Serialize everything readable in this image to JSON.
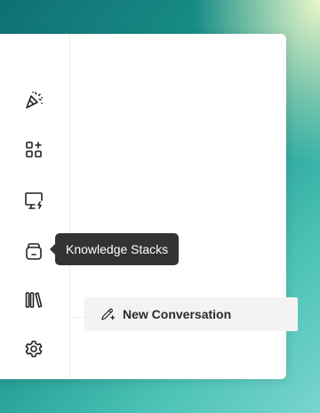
{
  "sidebar": {
    "items": [
      {
        "icon": "party-popper-icon"
      },
      {
        "icon": "grid-plus-icon"
      },
      {
        "icon": "monitor-bolt-icon"
      },
      {
        "icon": "knowledge-stack-icon"
      },
      {
        "icon": "library-books-icon"
      },
      {
        "icon": "gear-icon"
      }
    ]
  },
  "tooltip": {
    "text": "Knowledge Stacks"
  },
  "new_conversation": {
    "label": "New Conversation",
    "icon": "pen-plus-icon"
  },
  "colors": {
    "tooltip_bg": "#333333",
    "button_bg": "#f3f3f3",
    "icon_stroke": "#222222",
    "panel_bg": "#ffffff"
  }
}
